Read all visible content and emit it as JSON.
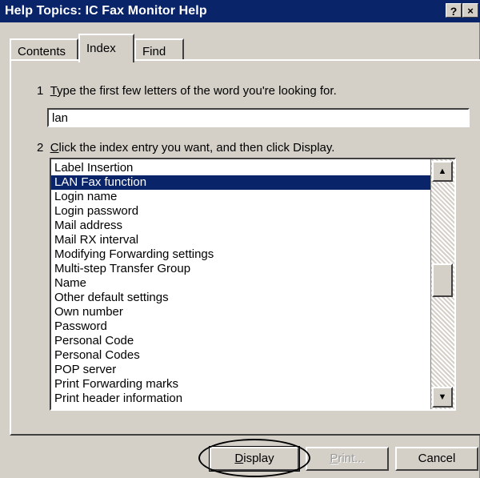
{
  "window": {
    "title": "Help Topics: IC Fax Monitor Help",
    "help_button": "?",
    "close_button": "×"
  },
  "tabs": [
    {
      "label": "Contents",
      "active": false
    },
    {
      "label": "Index",
      "active": true
    },
    {
      "label": "Find",
      "active": false
    }
  ],
  "step1": {
    "number": "1",
    "mnemonic": "T",
    "rest": "ype the first few letters of the word you're looking for."
  },
  "search": {
    "value": "lan"
  },
  "step2": {
    "number": "2",
    "mnemonic": "C",
    "rest": "lick the index entry you want, and then click Display."
  },
  "index_list": {
    "selected_index": 1,
    "items": [
      "Label Insertion",
      "LAN Fax function",
      "Login name",
      "Login password",
      "Mail address",
      "Mail RX interval",
      "Modifying Forwarding settings",
      "Multi-step Transfer Group",
      "Name",
      "Other default settings",
      "Own number",
      "Password",
      "Personal Code",
      "Personal Codes",
      "POP server",
      "Print Forwarding marks",
      "Print header information"
    ]
  },
  "scrollbar": {
    "up_icon": "▲",
    "down_icon": "▼"
  },
  "buttons": {
    "display": {
      "mnemonic": "D",
      "rest": "isplay"
    },
    "print": {
      "mnemonic": "P",
      "rest": "rint..."
    },
    "cancel": "Cancel"
  }
}
